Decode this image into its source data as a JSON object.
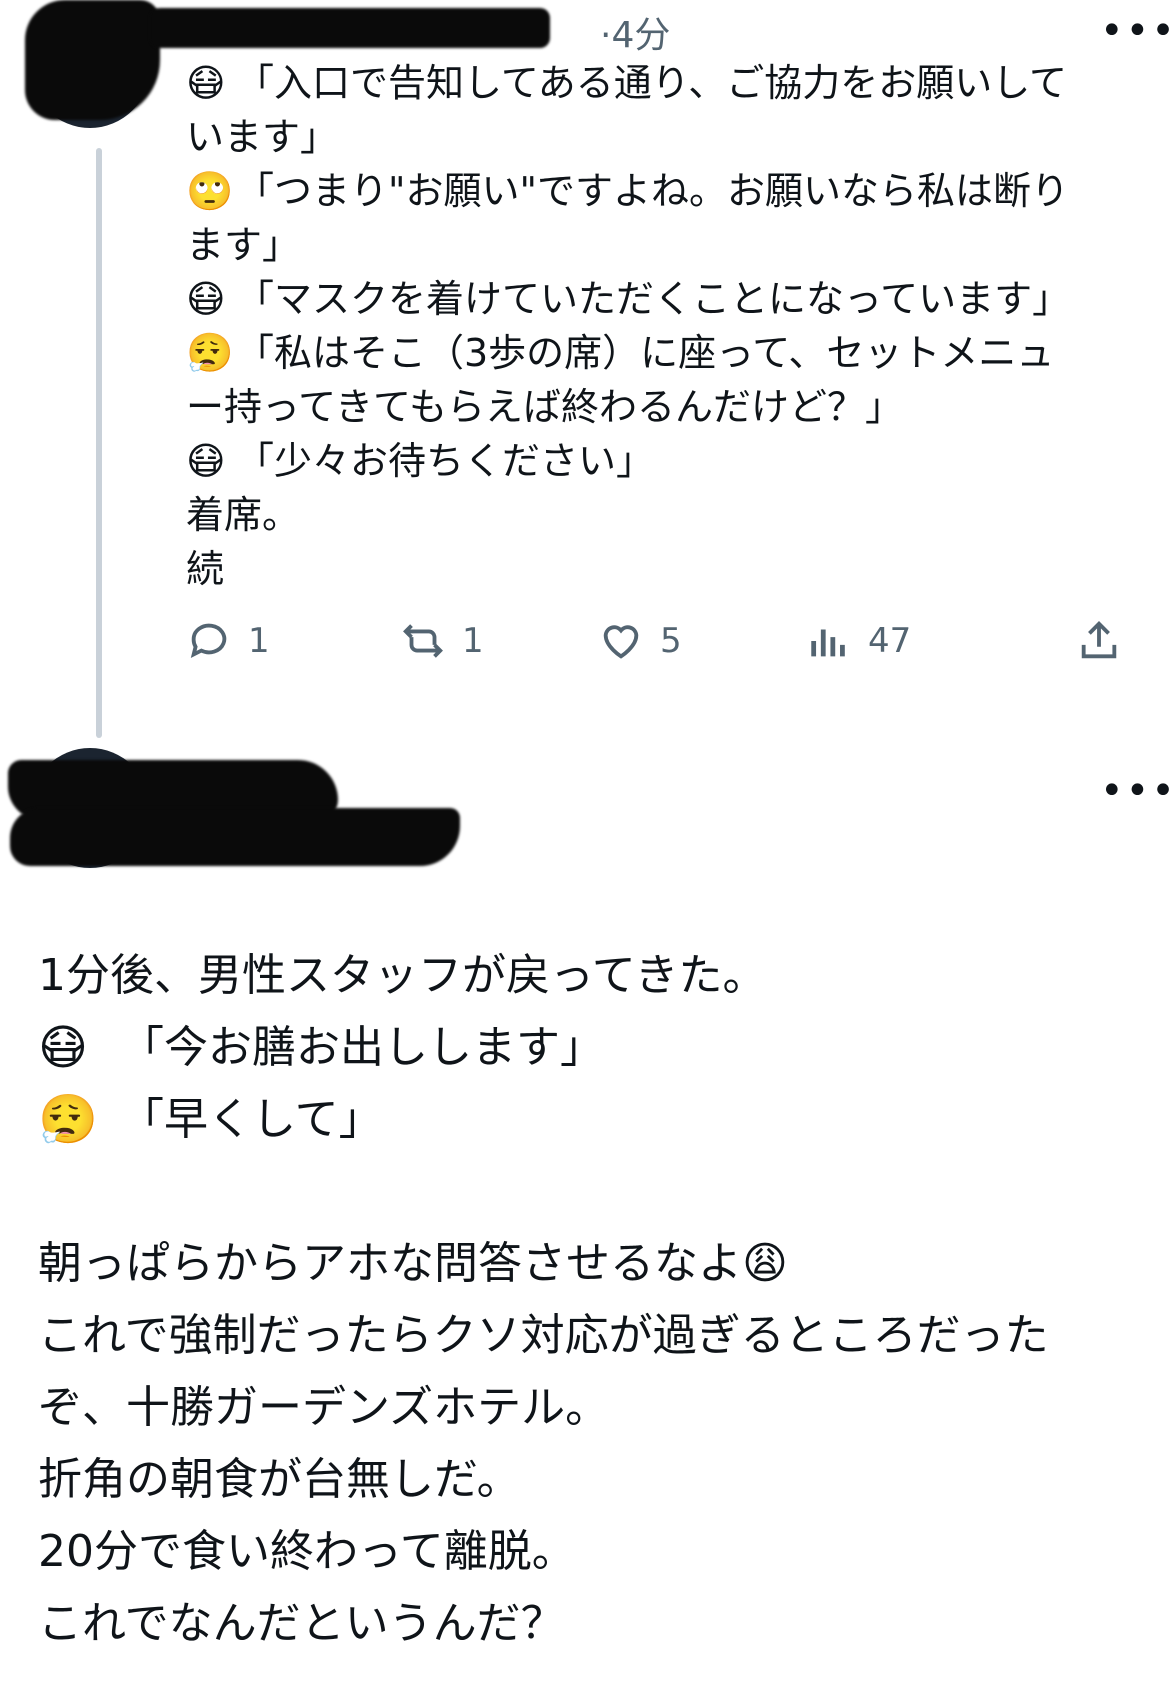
{
  "tweet1": {
    "time": "·4分",
    "lines": [
      {
        "emoji": "😷",
        "text": "「入口で告知してある通り、ご協力をお願いして"
      },
      {
        "emoji": "",
        "text": "います」"
      },
      {
        "emoji": "🙄",
        "text": "「つまり\"お願い\"ですよね。お願いなら私は断り"
      },
      {
        "emoji": "",
        "text": "ます」"
      },
      {
        "emoji": "😷",
        "text": "「マスクを着けていただくことになっています」"
      },
      {
        "emoji": "😮‍💨",
        "text": "「私はそこ（3歩の席）に座って、セットメニュ"
      },
      {
        "emoji": "",
        "text": "ー持ってきてもらえば終わるんだけど？」"
      },
      {
        "emoji": "😷",
        "text": "「少々お待ちください」"
      },
      {
        "emoji": "",
        "text": "着席。"
      },
      {
        "emoji": "",
        "text": "続"
      }
    ],
    "actions": {
      "reply_count": "1",
      "retweet_count": "1",
      "like_count": "5",
      "view_count": "47"
    }
  },
  "tweet2": {
    "lines": [
      {
        "emoji": "",
        "text": "1分後、男性スタッフが戻ってきた。"
      },
      {
        "emoji": "😷",
        "text": "「今お膳お出しします」"
      },
      {
        "emoji": "😮‍💨",
        "text": "「早くして」"
      },
      {
        "emoji": "",
        "text": ""
      },
      {
        "emoji": "",
        "text": "朝っぱらからアホな問答させるなよ😩"
      },
      {
        "emoji": "",
        "text": "これで強制だったらクソ対応が過ぎるところだった"
      },
      {
        "emoji": "",
        "text": "ぞ、十勝ガーデンズホテル。"
      },
      {
        "emoji": "",
        "text": "折角の朝食が台無しだ。"
      },
      {
        "emoji": "",
        "text": "20分で食い終わって離脱。"
      },
      {
        "emoji": "",
        "text": "これでなんだというんだ？"
      }
    ]
  },
  "icons": {
    "more": "more-options-icon",
    "reply": "reply-icon",
    "retweet": "retweet-icon",
    "like": "heart-icon",
    "views": "views-icon",
    "share": "share-icon"
  }
}
